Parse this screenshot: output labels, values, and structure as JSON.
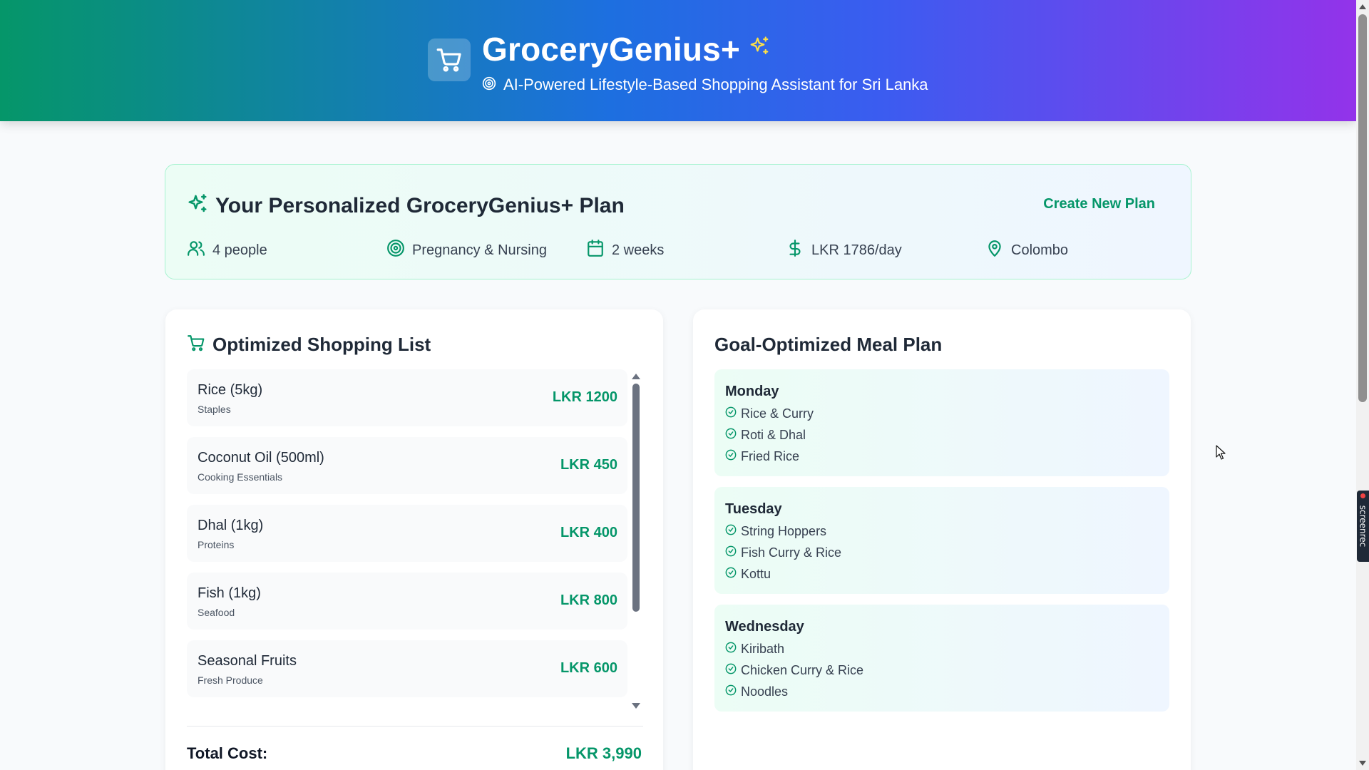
{
  "header": {
    "title": "GroceryGenius+",
    "subtitle": "AI-Powered Lifestyle-Based Shopping Assistant for Sri Lanka"
  },
  "plan": {
    "title": "Your Personalized GroceryGenius+ Plan",
    "create_label": "Create New Plan",
    "stats": {
      "people": "4 people",
      "goal": "Pregnancy & Nursing",
      "duration": "2 weeks",
      "budget": "LKR 1786/day",
      "location": "Colombo"
    }
  },
  "shopping": {
    "title": "Optimized Shopping List",
    "items": [
      {
        "name": "Rice (5kg)",
        "category": "Staples",
        "price": "LKR 1200"
      },
      {
        "name": "Coconut Oil (500ml)",
        "category": "Cooking Essentials",
        "price": "LKR 450"
      },
      {
        "name": "Dhal (1kg)",
        "category": "Proteins",
        "price": "LKR 400"
      },
      {
        "name": "Fish (1kg)",
        "category": "Seafood",
        "price": "LKR 800"
      },
      {
        "name": "Seasonal Fruits",
        "category": "Fresh Produce",
        "price": "LKR 600"
      }
    ],
    "total_label": "Total Cost:",
    "total_value": "LKR 3,990"
  },
  "meal_plan": {
    "title": "Goal-Optimized Meal Plan",
    "days": [
      {
        "day": "Monday",
        "meals": [
          "Rice & Curry",
          "Roti & Dhal",
          "Fried Rice"
        ]
      },
      {
        "day": "Tuesday",
        "meals": [
          "String Hoppers",
          "Fish Curry & Rice",
          "Kottu"
        ]
      },
      {
        "day": "Wednesday",
        "meals": [
          "Kiribath",
          "Chicken Curry & Rice",
          "Noodles"
        ]
      }
    ]
  },
  "overlay": {
    "recorder_label": "screenrec"
  },
  "colors": {
    "accent_green": "#059669",
    "sparkle_yellow": "#fde047"
  },
  "icons": {
    "logo": "shopping-cart-icon",
    "title_sparkle": "sparkles-icon",
    "subtitle": "target-icon",
    "people": "users-icon",
    "goal": "target-icon",
    "duration": "calendar-icon",
    "budget": "dollar-icon",
    "location": "map-pin-icon",
    "meal": "check-circle-icon"
  }
}
